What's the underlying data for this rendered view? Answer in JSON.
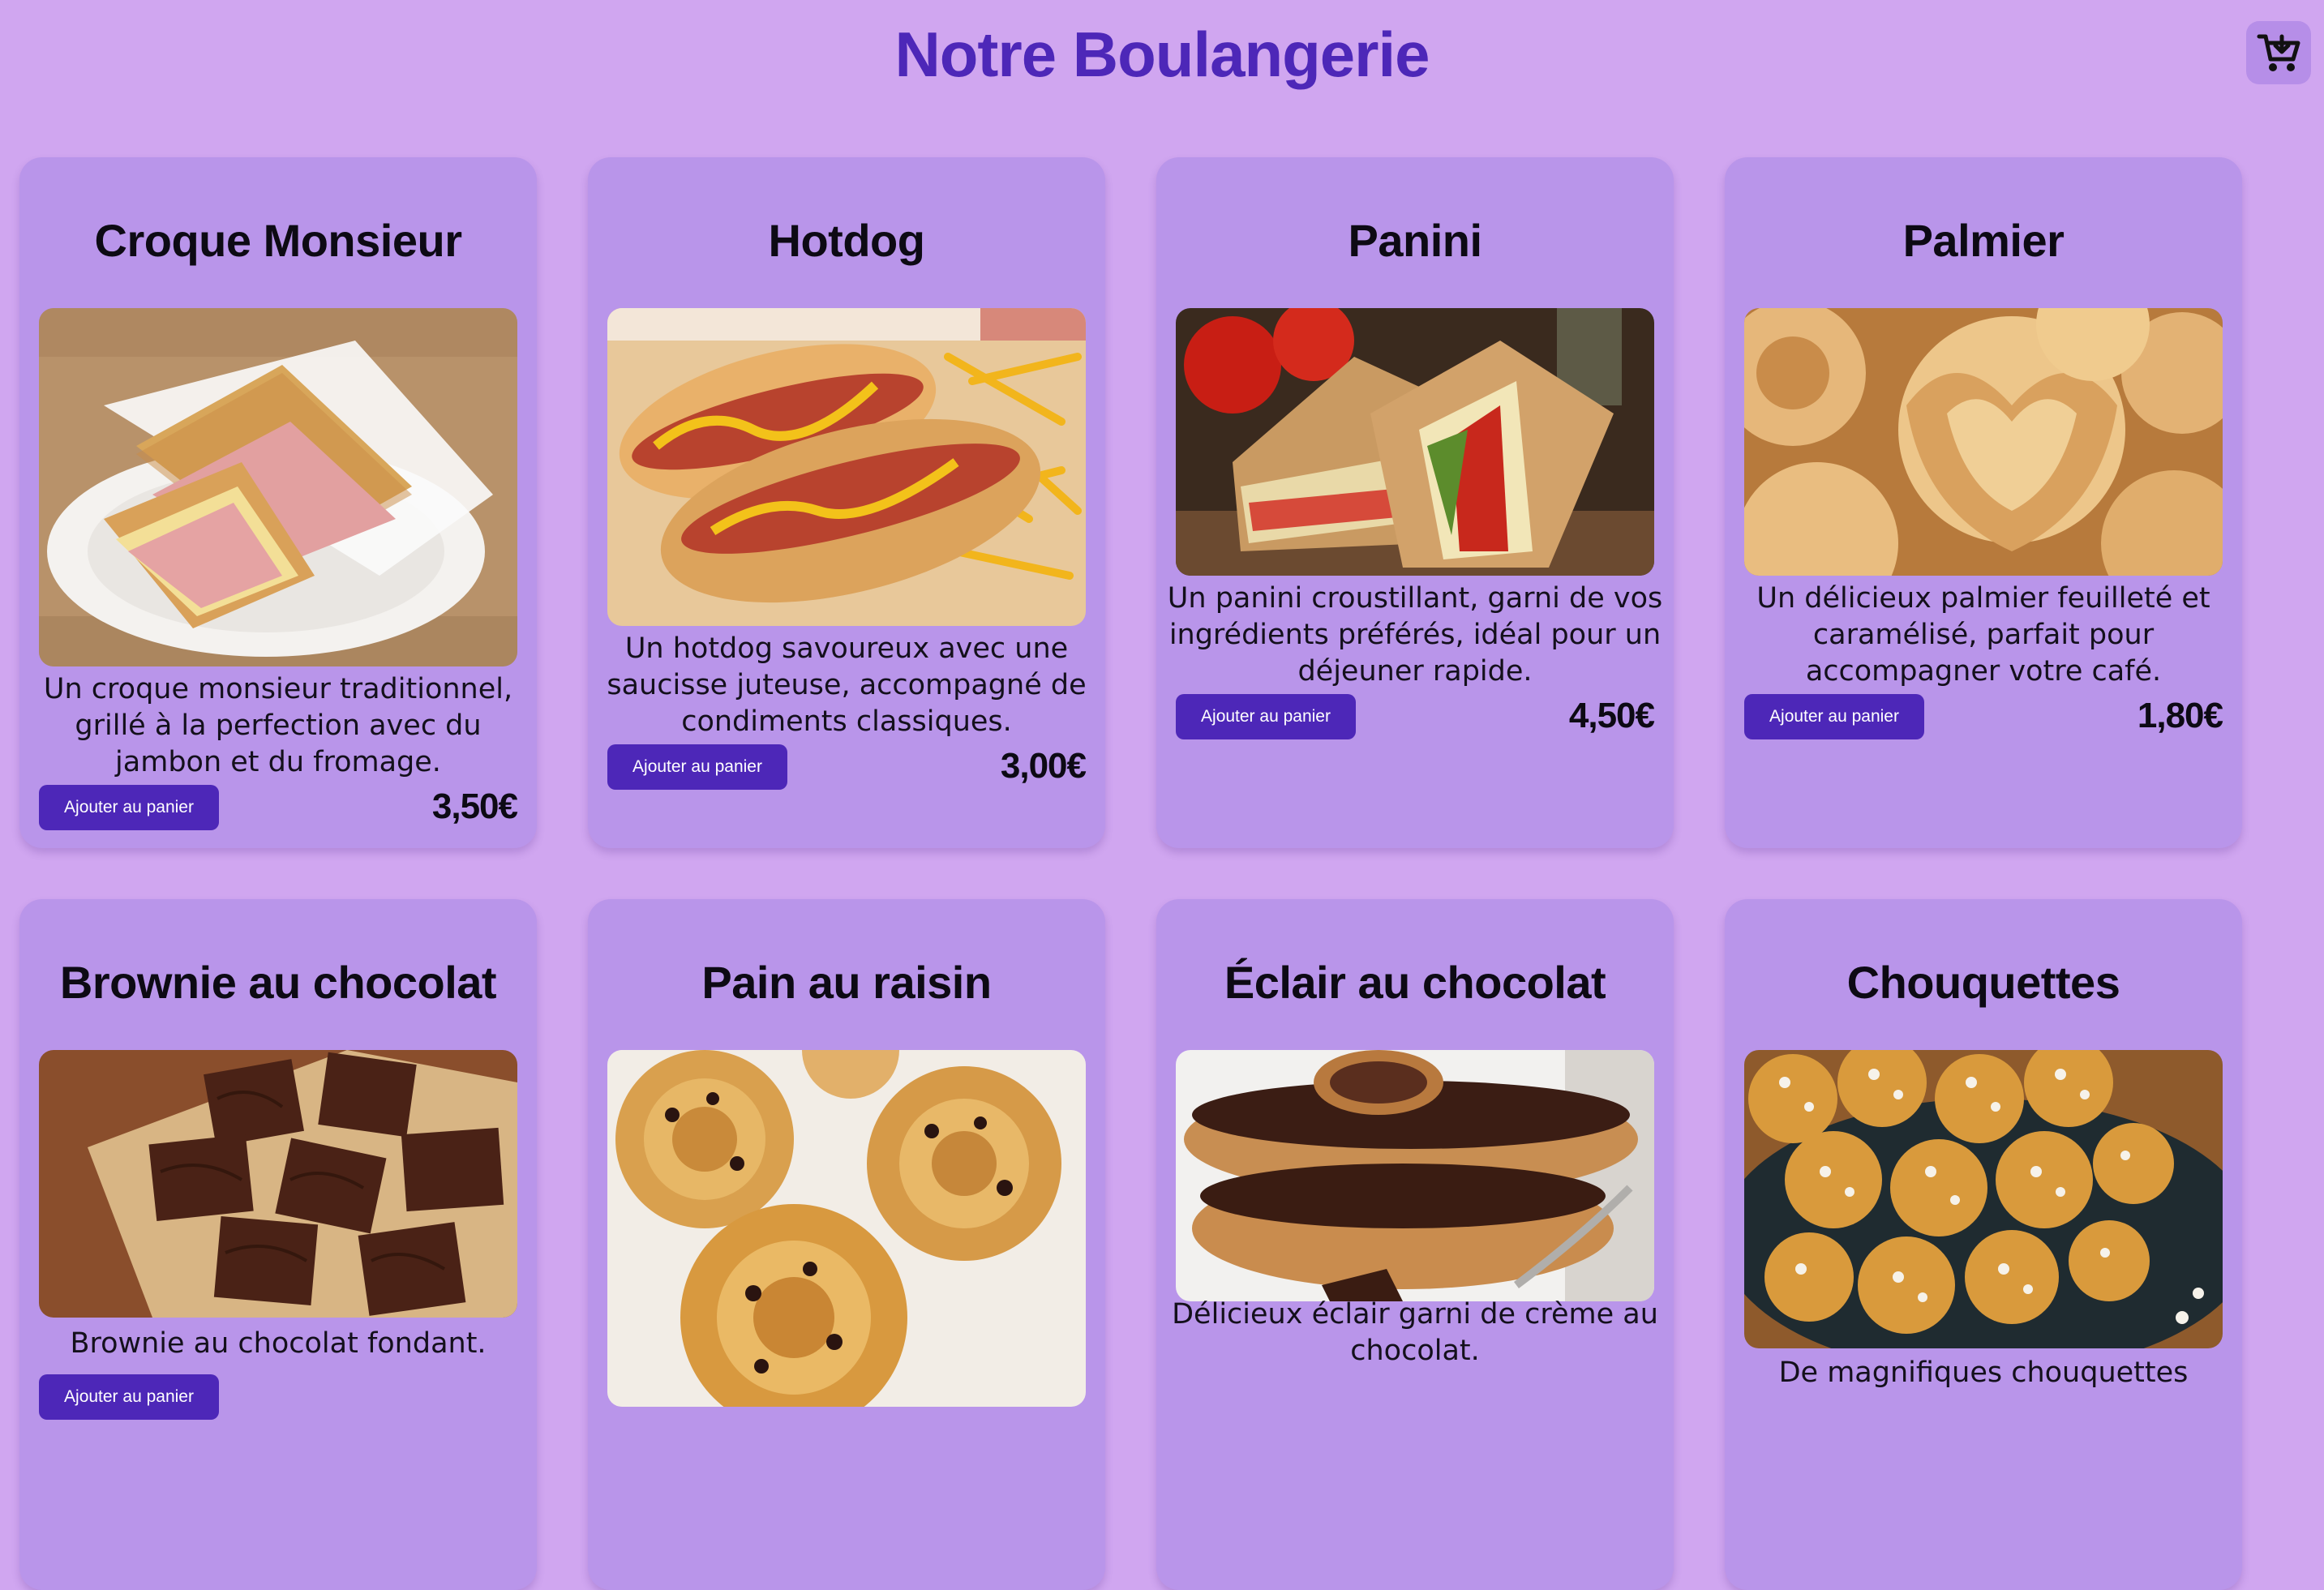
{
  "header": {
    "title": "Notre Boulangerie",
    "cart_icon": "shopping-cart-icon"
  },
  "colors": {
    "background": "#d0a6f0",
    "card": "#b995ea",
    "accent": "#4d27b8"
  },
  "products": [
    {
      "name": "Croque Monsieur",
      "description": "Un croque monsieur traditionnel, grillé à la perfection avec du jambon et du fromage.",
      "button": "Ajouter au panier",
      "price": "3,50€",
      "image": "croque-monsieur-photo"
    },
    {
      "name": "Hotdog",
      "description": "Un hotdog savoureux avec une saucisse juteuse, accompagné de condiments classiques.",
      "button": "Ajouter au panier",
      "price": "3,00€",
      "image": "hotdog-photo"
    },
    {
      "name": "Panini",
      "description": "Un panini croustillant, garni de vos ingrédients préférés, idéal pour un déjeuner rapide.",
      "button": "Ajouter au panier",
      "price": "4,50€",
      "image": "panini-photo"
    },
    {
      "name": "Palmier",
      "description": "Un délicieux palmier feuilleté et caramélisé, parfait pour accompagner votre café.",
      "button": "Ajouter au panier",
      "price": "1,80€",
      "image": "palmier-photo"
    },
    {
      "name": "Brownie au chocolat",
      "description": "Brownie au chocolat fondant.",
      "button": "Ajouter au panier",
      "price": "",
      "image": "brownie-photo"
    },
    {
      "name": "Pain au raisin",
      "description": "",
      "button": "",
      "price": "",
      "image": "pain-au-raisin-photo"
    },
    {
      "name": "Éclair au chocolat",
      "description": "Délicieux éclair garni de crème au chocolat.",
      "button": "",
      "price": "",
      "image": "eclair-photo"
    },
    {
      "name": "Chouquettes",
      "description": "De magnifiques chouquettes",
      "button": "",
      "price": "",
      "image": "chouquettes-photo"
    }
  ]
}
